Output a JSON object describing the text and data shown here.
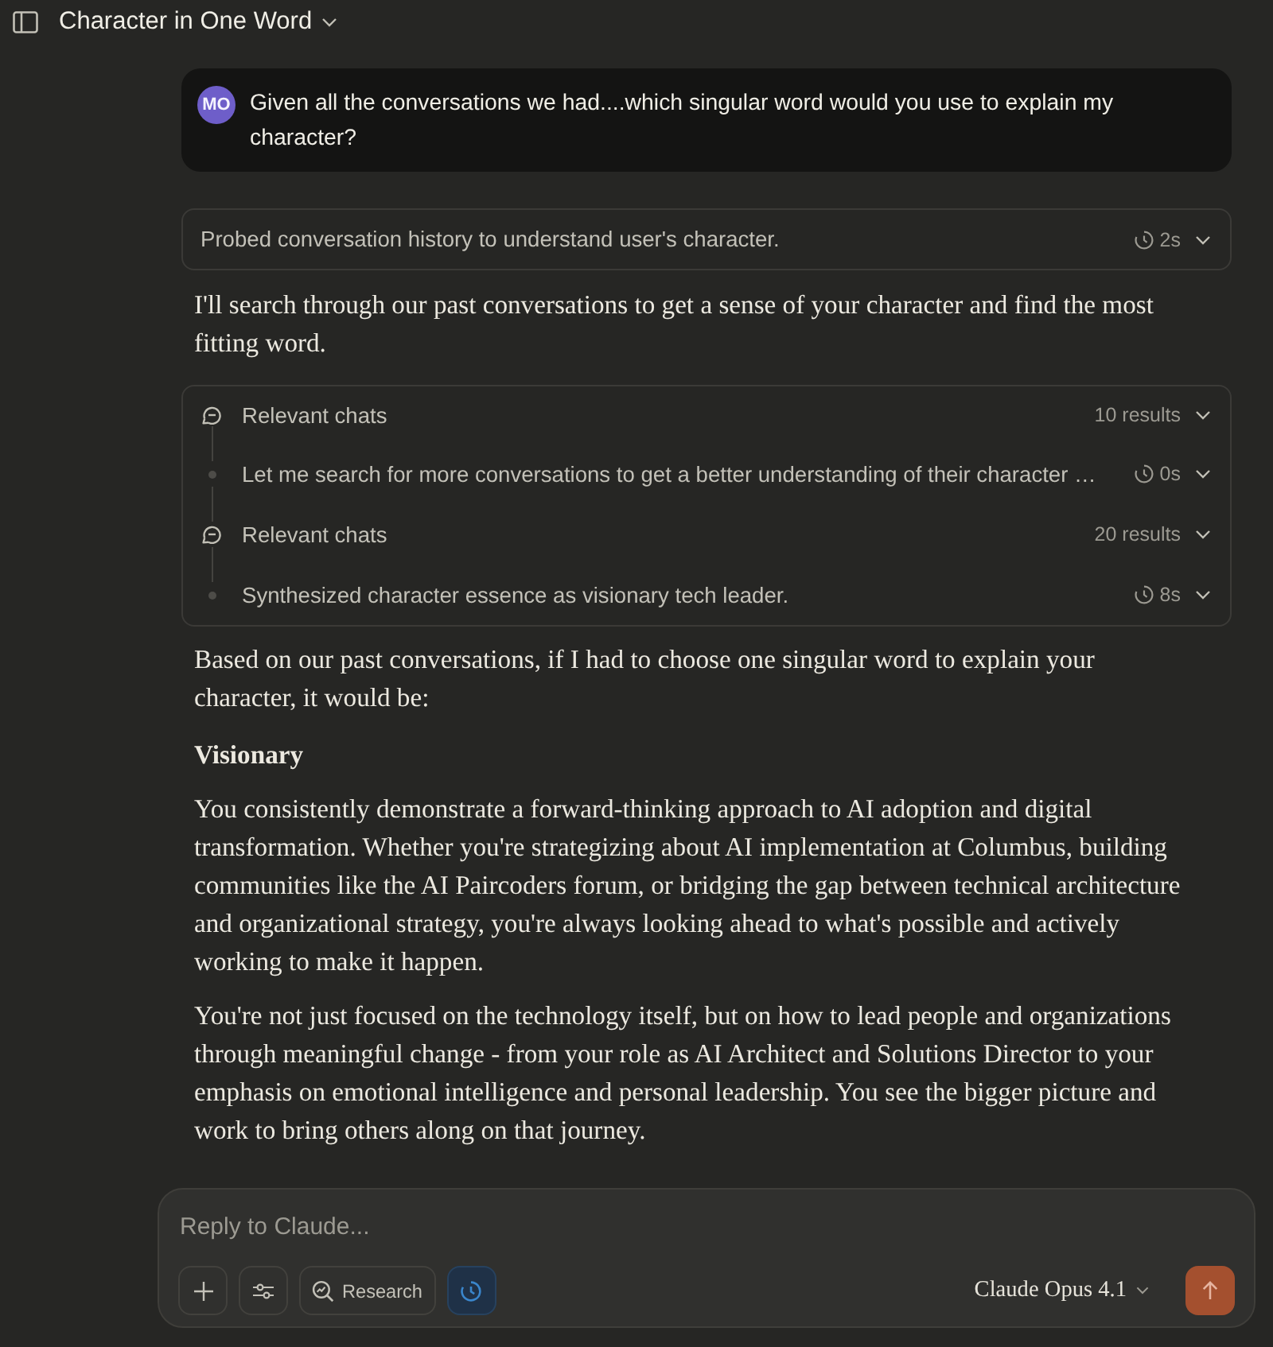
{
  "header": {
    "title": "Character in One Word"
  },
  "user_message": {
    "avatar": "MO",
    "text": "Given all the conversations we had....which singular word would you use to explain my character?"
  },
  "thinking": {
    "summary": "Probed conversation history to understand user's character.",
    "duration": "2s",
    "expanded": false
  },
  "intro": "I'll search through our past conversations to get a sense of your character and find the most fitting word.",
  "tool_steps": [
    {
      "kind": "search",
      "label": "Relevant chats",
      "meta": "10 results",
      "expanded": false
    },
    {
      "kind": "thought",
      "label": "Let me search for more conversations to get a better understanding of their character …",
      "meta": "0s",
      "expanded": false
    },
    {
      "kind": "search",
      "label": "Relevant chats",
      "meta": "20 results",
      "expanded": false
    },
    {
      "kind": "thought",
      "label": "Synthesized character essence as visionary tech leader.",
      "meta": "8s",
      "expanded": false
    }
  ],
  "response": [
    {
      "kind": "paragraph",
      "text": "Based on our past conversations, if I had to choose one singular word to explain your character, it would be:"
    },
    {
      "kind": "heading",
      "text": "Visionary"
    },
    {
      "kind": "paragraph",
      "text": "You consistently demonstrate a forward-thinking approach to AI adoption and digital transformation. Whether you're strategizing about AI implementation at Columbus, building communities like the AI Paircoders forum, or bridging the gap between technical architecture and organizational strategy, you're always looking ahead to what's possible and actively working to make it happen."
    },
    {
      "kind": "paragraph",
      "text": "You're not just focused on the technology itself, but on how to lead people and organizations through meaningful change - from your role as AI Architect and Solutions Director to your emphasis on emotional intelligence and personal leadership. You see the bigger picture and work to bring others along on that journey."
    }
  ],
  "composer": {
    "placeholder": "Reply to Claude...",
    "tools": [
      {
        "kind": "add",
        "on": false
      },
      {
        "kind": "options",
        "on": false
      },
      {
        "kind": "research",
        "label": "Research",
        "on": false
      },
      {
        "kind": "timer",
        "on": true
      }
    ],
    "model": "Claude Opus 4.1"
  }
}
